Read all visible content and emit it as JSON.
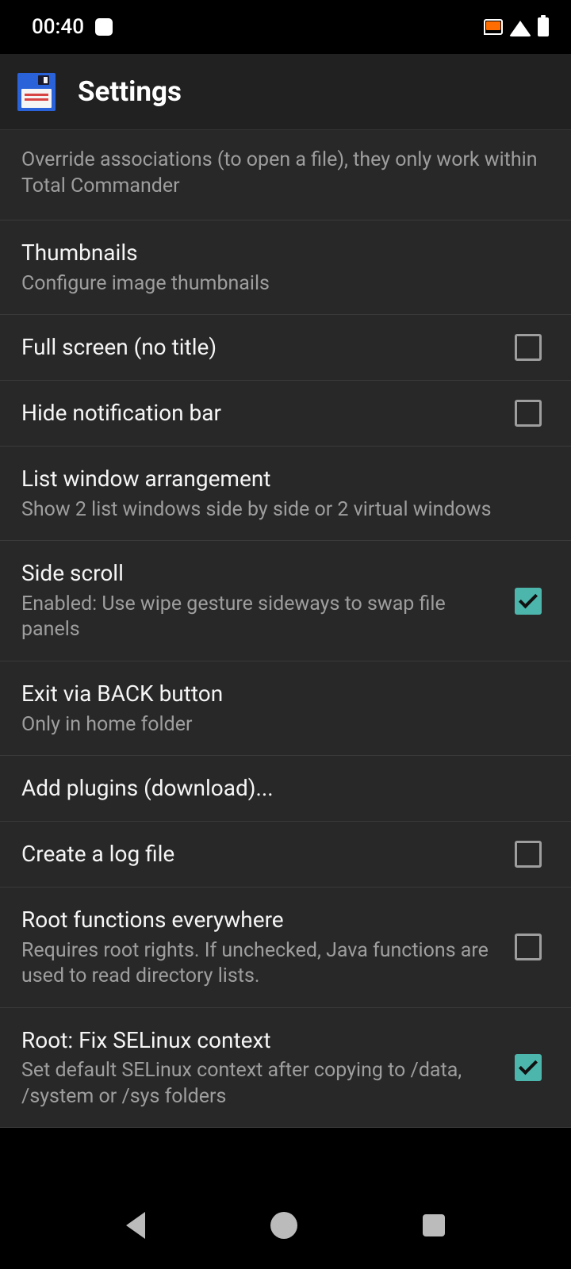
{
  "status": {
    "time": "00:40"
  },
  "header": {
    "title": "Settings"
  },
  "items": [
    {
      "subtitle": "Override associations (to open a file), they only work within Total Commander",
      "has_checkbox": false
    },
    {
      "title": "Thumbnails",
      "subtitle": "Configure image thumbnails",
      "has_checkbox": false
    },
    {
      "title": "Full screen (no title)",
      "has_checkbox": true,
      "checked": false
    },
    {
      "title": "Hide notification bar",
      "has_checkbox": true,
      "checked": false
    },
    {
      "title": "List window arrangement",
      "subtitle": "Show 2 list windows side by side or 2 virtual windows",
      "has_checkbox": false
    },
    {
      "title": "Side scroll",
      "subtitle": "Enabled: Use wipe gesture sideways to swap file panels",
      "has_checkbox": true,
      "checked": true
    },
    {
      "title": "Exit via BACK button",
      "subtitle": "Only in home folder",
      "has_checkbox": false
    },
    {
      "title": "Add plugins (download)...",
      "has_checkbox": false
    },
    {
      "title": "Create a log file",
      "has_checkbox": true,
      "checked": false
    },
    {
      "title": "Root functions everywhere",
      "subtitle": "Requires root rights. If unchecked, Java functions are used to read directory lists.",
      "has_checkbox": true,
      "checked": false
    },
    {
      "title": "Root: Fix SELinux context",
      "subtitle": "Set default SELinux context after copying to /data, /system or /sys folders",
      "has_checkbox": true,
      "checked": true
    }
  ]
}
